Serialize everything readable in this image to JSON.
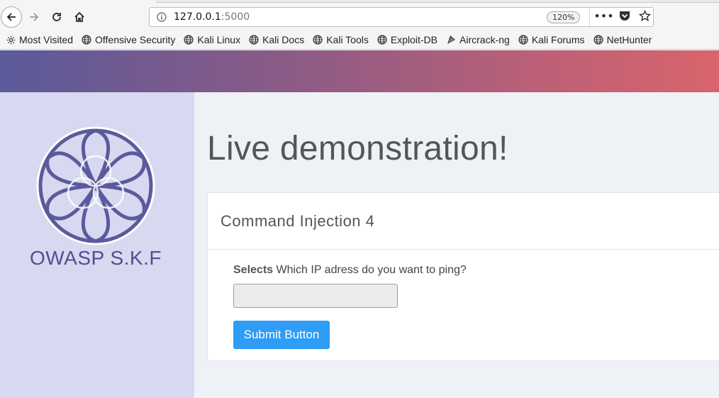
{
  "browser": {
    "url_host": "127.0.0.1",
    "url_port": ":5000",
    "zoom": "120%",
    "bookmarks": [
      {
        "label": "Most Visited",
        "icon": "gear-icon"
      },
      {
        "label": "Offensive Security",
        "icon": "globe-icon"
      },
      {
        "label": "Kali Linux",
        "icon": "globe-icon"
      },
      {
        "label": "Kali Docs",
        "icon": "globe-icon"
      },
      {
        "label": "Kali Tools",
        "icon": "globe-icon"
      },
      {
        "label": "Exploit-DB",
        "icon": "globe-icon"
      },
      {
        "label": "Aircrack-ng",
        "icon": "aircrack-icon"
      },
      {
        "label": "Kali Forums",
        "icon": "globe-icon"
      },
      {
        "label": "NetHunter",
        "icon": "globe-icon"
      }
    ]
  },
  "sidebar": {
    "brand": "OWASP S.K.F"
  },
  "main": {
    "title": "Live demonstration!",
    "card_title": "Command Injection 4",
    "label_bold": "Selects",
    "label_text": " Which IP adress do you want to ping?",
    "input_value": "",
    "submit_label": "Submit Button"
  },
  "colors": {
    "gradient_start": "#5b5a9a",
    "gradient_end": "#d9646b",
    "sidebar_bg": "#d8d8f0",
    "logo": "#4e4f94",
    "button": "#2f9cf5"
  }
}
